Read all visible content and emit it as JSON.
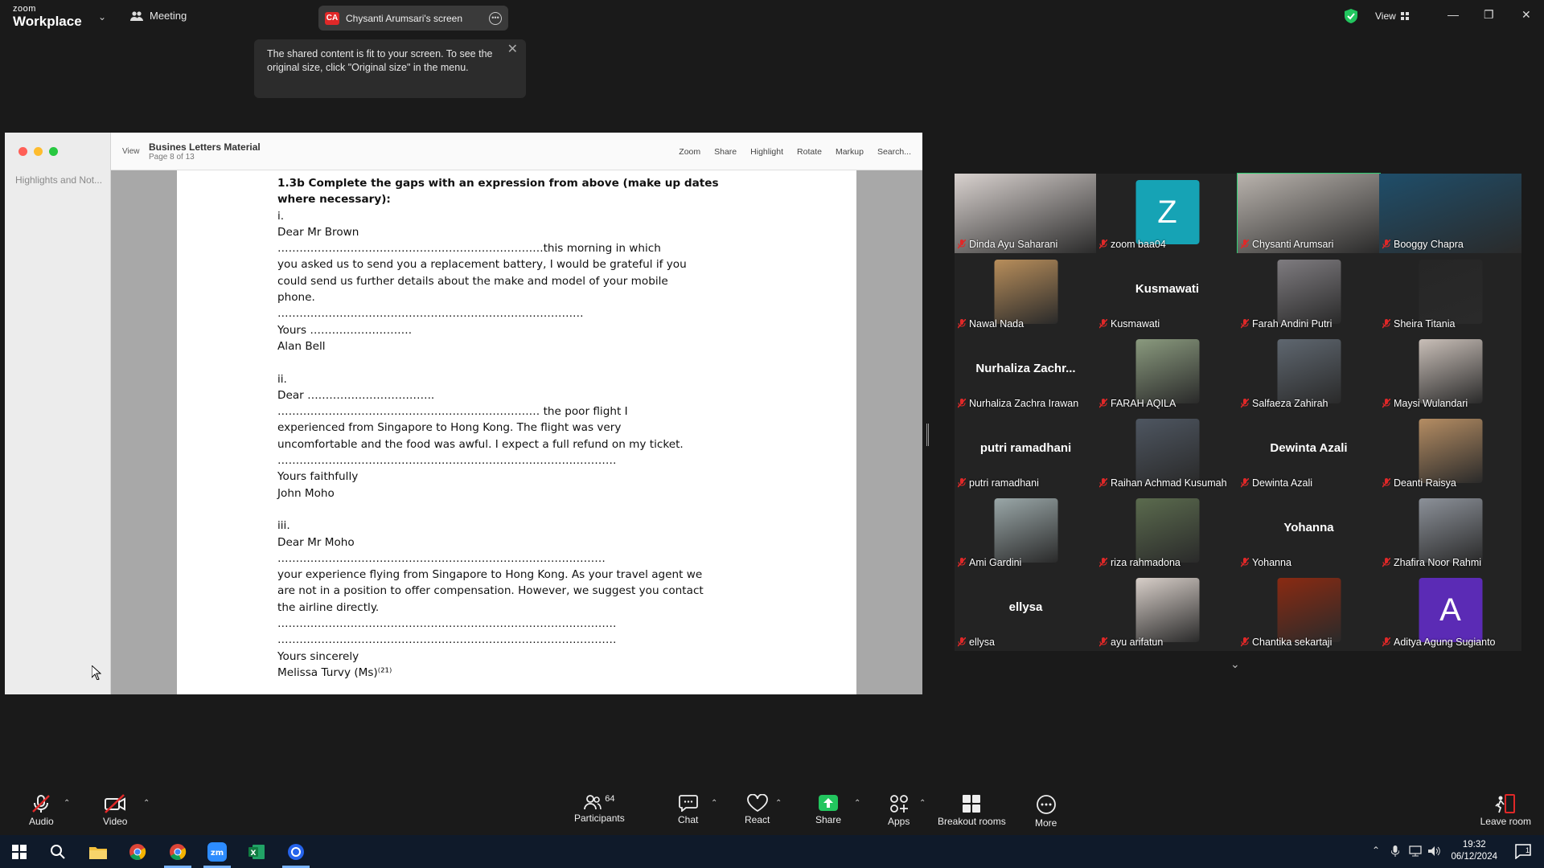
{
  "app": {
    "logo_small": "zoom",
    "logo_big": "Workplace",
    "meeting_label": "Meeting",
    "share_badge": "CA",
    "share_label": "Chysanti Arumsari's screen",
    "view_label": "View"
  },
  "tooltip": {
    "text": "The shared content is fit to your screen. To see the original size, click \"Original size\" in the menu."
  },
  "viewer": {
    "sidebar_label": "Highlights and Not...",
    "view_label": "View",
    "doc_title": "Busines Letters Material",
    "doc_page": "Page 8 of 13",
    "tools": [
      "Zoom",
      "Share",
      "Highlight",
      "Rotate",
      "Markup",
      "Search..."
    ],
    "lines": [
      {
        "t": "1.3b Complete the gaps with an expression from above (make up dates",
        "b": true
      },
      {
        "t": "where necessary):",
        "b": true
      },
      {
        "t": "i.",
        "b": false
      },
      {
        "t": "Dear Mr Brown",
        "b": false
      },
      {
        "t": "……………………………………………………………….this morning in which",
        "b": false
      },
      {
        "t": "you asked us to send you a replacement battery, I would be grateful if you",
        "b": false
      },
      {
        "t": "could send us further details about the make and model of your mobile",
        "b": false
      },
      {
        "t": "phone.",
        "b": false
      },
      {
        "t": "…………………………………………………………………………",
        "b": false
      },
      {
        "t": "Yours ……………………….",
        "b": false
      },
      {
        "t": "Alan Bell",
        "b": false
      },
      {
        "t": "",
        "b": false
      },
      {
        "t": "ii.",
        "b": false
      },
      {
        "t": "Dear ……………………………..",
        "b": false
      },
      {
        "t": "……………………………………………………………… the poor flight I",
        "b": false
      },
      {
        "t": "experienced from Singapore to Hong Kong. The flight was very",
        "b": false
      },
      {
        "t": "uncomfortable and the food was awful. I expect a full refund on my ticket.",
        "b": false
      },
      {
        "t": "…………………………………………………………………………………",
        "b": false
      },
      {
        "t": "Yours faithfully",
        "b": false
      },
      {
        "t": "John Moho",
        "b": false
      },
      {
        "t": "",
        "b": false
      },
      {
        "t": "iii.",
        "b": false
      },
      {
        "t": "Dear Mr Moho",
        "b": false
      },
      {
        "t": "………………………………………………………………………………",
        "b": false
      },
      {
        "t": "your experience flying from Singapore to Hong Kong. As your travel agent we",
        "b": false
      },
      {
        "t": "are not in a position to offer compensation. However, we suggest you contact",
        "b": false
      },
      {
        "t": "the airline directly.",
        "b": false
      },
      {
        "t": "…………………………………………………………………………………",
        "b": false
      },
      {
        "t": "…………………………………………………………………………………",
        "b": false
      },
      {
        "t": "Yours sincerely",
        "b": false
      },
      {
        "t": "Melissa Turvy (Ms)⁽²¹⁾",
        "b": false
      }
    ]
  },
  "participants_grid": [
    {
      "name": "Dinda Ayu Saharani",
      "kind": "video",
      "color": "#d9d2cf",
      "active": false
    },
    {
      "name": "zoom baa04",
      "kind": "avatar",
      "letter": "Z",
      "color": "#16a3b5",
      "active": false
    },
    {
      "name": "Chysanti Arumsari",
      "kind": "video",
      "color": "#b9b3ad",
      "active": true
    },
    {
      "name": "Booggy Chapra",
      "kind": "video",
      "color": "#1f4e6a",
      "active": false
    },
    {
      "name": "Nawal Nada",
      "kind": "thumb",
      "color": "#b88e5b",
      "active": false
    },
    {
      "name": "Kusmawati",
      "kind": "text",
      "big": "Kusmawati",
      "active": false
    },
    {
      "name": "Farah Andini Putri",
      "kind": "thumb",
      "color": "#7f7c80",
      "active": false
    },
    {
      "name": "Sheira Titania",
      "kind": "thumb",
      "color": "#262626",
      "active": false
    },
    {
      "name": "Nurhaliza Zachra Irawan",
      "kind": "text",
      "big": "Nurhaliza  Zachr...",
      "active": false
    },
    {
      "name": "FARAH AQILA",
      "kind": "thumb",
      "color": "#8a9a7e",
      "active": false
    },
    {
      "name": "Salfaeza Zahirah",
      "kind": "thumb",
      "color": "#5f6770",
      "active": false
    },
    {
      "name": "Maysi Wulandari",
      "kind": "thumb",
      "color": "#c9bfb8",
      "active": false
    },
    {
      "name": "putri ramadhani",
      "kind": "text",
      "big": "putri ramadhani",
      "active": false
    },
    {
      "name": "Raihan Achmad Kusumah",
      "kind": "thumb",
      "color": "#4e5661",
      "active": false
    },
    {
      "name": "Dewinta Azali",
      "kind": "text",
      "big": "Dewinta Azali",
      "active": false
    },
    {
      "name": "Deanti Raisya",
      "kind": "thumb",
      "color": "#b58d63",
      "active": false
    },
    {
      "name": "Ami Gardini",
      "kind": "thumb",
      "color": "#9aa7a8",
      "active": false
    },
    {
      "name": "riza rahmadona",
      "kind": "thumb",
      "color": "#5b6b4e",
      "active": false
    },
    {
      "name": "Yohanna",
      "kind": "text",
      "big": "Yohanna",
      "active": false
    },
    {
      "name": "Zhafira Noor Rahmi",
      "kind": "thumb",
      "color": "#8c9199",
      "active": false
    },
    {
      "name": "ellysa",
      "kind": "text",
      "big": "ellysa",
      "active": false
    },
    {
      "name": "ayu arifatun",
      "kind": "thumb",
      "color": "#d8cfc9",
      "active": false
    },
    {
      "name": "Chantika sekartaji",
      "kind": "thumb",
      "color": "#8a2a12",
      "active": false
    },
    {
      "name": "Aditya Agung Sugianto",
      "kind": "avatar",
      "letter": "A",
      "color": "#5b2bb5",
      "active": false
    }
  ],
  "bottom_bar": {
    "audio": "Audio",
    "video": "Video",
    "participants": "Participants",
    "participants_count": "64",
    "chat": "Chat",
    "react": "React",
    "share": "Share",
    "apps": "Apps",
    "breakout": "Breakout rooms",
    "more": "More",
    "leave": "Leave room"
  },
  "taskbar": {
    "time": "19:32",
    "date": "06/12/2024",
    "notifications": "1"
  },
  "colors": {
    "accent_green": "#2ecc71",
    "share_green": "#22c55e",
    "mute_red": "#e02828"
  }
}
